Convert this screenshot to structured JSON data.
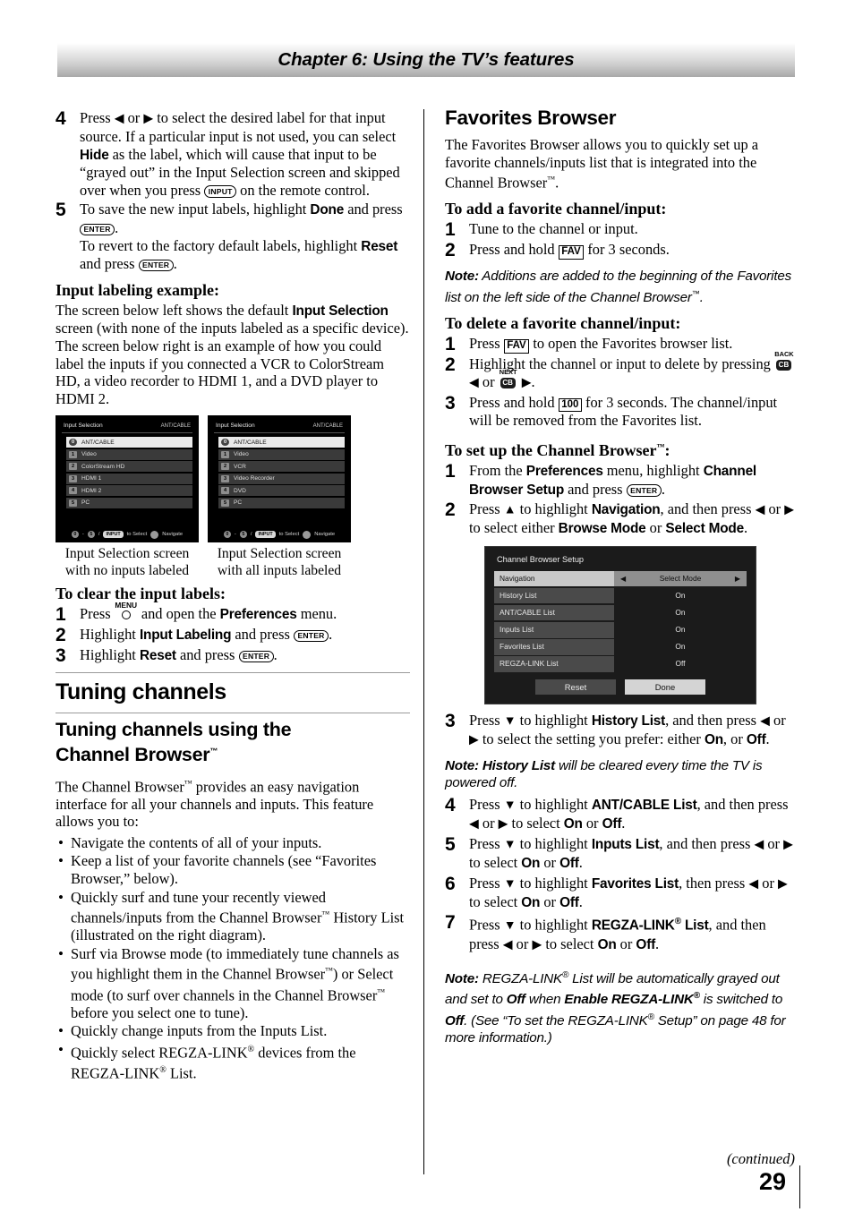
{
  "header": {
    "chapter_title": "Chapter 6: Using the TV’s features"
  },
  "left_column": {
    "step4": {
      "num": "4",
      "t1": "Press ",
      "t2": " or ",
      "t3": " to select the desired label for that input source. If a particular input is not used, you can select ",
      "bold1": "Hide",
      "t4": " as the label, which will cause that input to be “grayed out” in the Input Selection screen and skipped over when you press ",
      "key_input": "INPUT",
      "t5": " on the remote control."
    },
    "step5": {
      "num": "5",
      "t1": "To save the new input labels, highlight ",
      "bold1": "Done",
      "t2": " and press ",
      "key_enter": "ENTER",
      "t3": ".",
      "t4": "To revert to the factory default labels, highlight ",
      "bold2": "Reset",
      "t5": " and press ",
      "t6": "."
    },
    "input_labeling_heading": "Input labeling example:",
    "input_labeling_body_1": "The screen below left shows the default ",
    "input_labeling_bold": "Input Selection",
    "input_labeling_body_2": " screen (with none of the inputs labeled as a specific device). The screen below right is an example of how you could label the inputs if you connected a VCR to ColorStream HD, a video recorder to HDMI 1, and a DVD player to HDMI 2.",
    "osd_left": {
      "title": "Input Selection",
      "source": "ANT/CABLE",
      "items": [
        {
          "num": "0",
          "label": "ANT/CABLE",
          "selected": true
        },
        {
          "num": "1",
          "label": "Video",
          "selected": false
        },
        {
          "num": "2",
          "label": "ColorStream HD",
          "selected": false
        },
        {
          "num": "3",
          "label": "HDMI 1",
          "selected": false
        },
        {
          "num": "4",
          "label": "HDMI 2",
          "selected": false
        },
        {
          "num": "5",
          "label": "PC",
          "selected": false
        }
      ],
      "footer": {
        "range_from": "0",
        "dash": "-",
        "range_to": "5",
        "slash": "/",
        "key": "INPUT",
        "select_text": "to Select",
        "navigate_text": "Navigate"
      },
      "caption": "Input Selection screen with no inputs labeled"
    },
    "osd_right": {
      "title": "Input Selection",
      "source": "ANT/CABLE",
      "items": [
        {
          "num": "0",
          "label": "ANT/CABLE",
          "selected": true
        },
        {
          "num": "1",
          "label": "Video",
          "selected": false
        },
        {
          "num": "2",
          "label": "VCR",
          "selected": false
        },
        {
          "num": "3",
          "label": "Video Recorder",
          "selected": false
        },
        {
          "num": "4",
          "label": "DVD",
          "selected": false
        },
        {
          "num": "5",
          "label": "PC",
          "selected": false
        }
      ],
      "footer": {
        "range_from": "0",
        "dash": "-",
        "range_to": "5",
        "slash": "/",
        "key": "INPUT",
        "select_text": "to Select",
        "navigate_text": "Navigate"
      },
      "caption": "Input Selection screen with all inputs labeled"
    },
    "clear_heading": "To clear the input labels:",
    "clear_step1": {
      "num": "1",
      "t1": "Press ",
      "key_menu": "MENU",
      "t2": " and open the ",
      "bold1": "Preferences",
      "t3": " menu."
    },
    "clear_step2": {
      "num": "2",
      "t1": "Highlight ",
      "bold1": "Input Labeling",
      "t2": " and press ",
      "key_enter": "ENTER",
      "t3": "."
    },
    "clear_step3": {
      "num": "3",
      "t1": "Highlight ",
      "bold1": "Reset",
      "t2": " and press ",
      "key_enter": "ENTER",
      "t3": "."
    },
    "section_title": "Tuning channels",
    "subsection_title_line1": "Tuning channels using the",
    "subsection_title_line2": "Channel Browser",
    "subsection_tm": "™",
    "intro_1": "The Channel Browser",
    "intro_tm": "™",
    "intro_2": " provides an easy navigation interface for all your channels and inputs. This feature allows you to:",
    "bullets": [
      {
        "parts": [
          "Navigate the contents of all of your inputs."
        ]
      },
      {
        "parts": [
          "Keep a list of your favorite channels (see “Favorites Browser,” below)."
        ]
      },
      {
        "parts": [
          "Quickly surf and tune your recently viewed channels/inputs from the Channel Browser",
          "™",
          " History List (illustrated on the right diagram)."
        ]
      },
      {
        "parts": [
          "Surf via Browse mode (to immediately tune channels as you highlight them in the Channel Browser",
          "™",
          ") or Select mode (to surf over channels in the Channel Browser",
          "™",
          " before you select one to tune)."
        ]
      },
      {
        "parts": [
          "Quickly change inputs from the Inputs List."
        ]
      },
      {
        "parts": [
          "Quickly select REGZA-LINK",
          "®",
          " devices from the REGZA-LINK",
          "®",
          " List."
        ]
      }
    ]
  },
  "right_column": {
    "fav_heading": "Favorites Browser",
    "fav_intro_1": "The Favorites Browser allows you to quickly set up a favorite channels/inputs list that is integrated into the Channel Browser",
    "fav_intro_tm": "™",
    "fav_intro_2": ".",
    "add_heading": "To add a favorite channel/input:",
    "add_step1": {
      "num": "1",
      "text": "Tune to the channel or input."
    },
    "add_step2": {
      "num": "2",
      "t1": "Press and hold ",
      "key_fav": "FAV",
      "t2": " for 3 seconds."
    },
    "note_add": {
      "label": "Note:",
      "t1": " Additions are added to the beginning of the Favorites list on the left side of the Channel Browser",
      "tm": "™",
      "t2": "."
    },
    "delete_heading": "To delete a favorite channel/input:",
    "del_step1": {
      "num": "1",
      "t1": "Press ",
      "key_fav": "FAV",
      "t2": " to open the Favorites browser list."
    },
    "del_step2": {
      "num": "2",
      "t1": "Highlight the channel or input to delete by pressing ",
      "key_back_label": "BACK",
      "key_cb": "CB",
      "t2": " or ",
      "key_next_label": "NEXT",
      "t3": "."
    },
    "del_step3": {
      "num": "3",
      "t1": "Press and hold ",
      "key_100": "100",
      "t2": " for 3 seconds. The channel/input will be removed from the Favorites list."
    },
    "setup_heading_1": "To set up the Channel Browser",
    "setup_heading_tm": "™",
    "setup_heading_2": ":",
    "setup_step1": {
      "num": "1",
      "t1": "From the ",
      "bold1": "Preferences",
      "t2": " menu, highlight ",
      "bold2": "Channel Browser Setup",
      "t3": " and press ",
      "key_enter": "ENTER",
      "t4": "."
    },
    "setup_step2": {
      "num": "2",
      "t1": "Press ",
      "t2": " to highlight ",
      "bold1": "Navigation",
      "t3": ", and then press ",
      "t4": " or ",
      "t5": " to select either ",
      "bold2": "Browse Mode",
      "t6": " or ",
      "bold3": "Select Mode",
      "t7": "."
    },
    "cbs_osd": {
      "title": "Channel Browser Setup",
      "rows": [
        {
          "label": "Navigation",
          "value": "Select Mode",
          "highlighted": true
        },
        {
          "label": "History List",
          "value": "On",
          "highlighted": false
        },
        {
          "label": "ANT/CABLE List",
          "value": "On",
          "highlighted": false
        },
        {
          "label": "Inputs List",
          "value": "On",
          "highlighted": false
        },
        {
          "label": "Favorites List",
          "value": "On",
          "highlighted": false
        },
        {
          "label": "REGZA-LINK List",
          "value": "Off",
          "highlighted": false
        }
      ],
      "reset_label": "Reset",
      "done_label": "Done"
    },
    "setup_step3": {
      "num": "3",
      "t1": "Press ",
      "t2": " to highlight ",
      "bold1": "History List",
      "t3": ", and then press ",
      "t4": " or ",
      "t5": " to select the setting you prefer: either ",
      "bold2": "On",
      "t6": ", or ",
      "bold3": "Off",
      "t7": "."
    },
    "note_history": {
      "label": "Note: History List",
      "text": " will be cleared every time the TV is powered off."
    },
    "setup_step4": {
      "num": "4",
      "t1": "Press ",
      "t2": " to highlight ",
      "bold1": "ANT/CABLE List",
      "t3": ", and then press ",
      "t4": " or ",
      "t5": " to select ",
      "bold2": "On",
      "t6": " or ",
      "bold3": "Off",
      "t7": "."
    },
    "setup_step5": {
      "num": "5",
      "t1": "Press ",
      "t2": " to highlight ",
      "bold1": "Inputs List",
      "t3": ", and then press ",
      "t4": " or ",
      "t5": " to select ",
      "bold2": "On",
      "t6": " or ",
      "bold3": "Off",
      "t7": "."
    },
    "setup_step6": {
      "num": "6",
      "t1": "Press ",
      "t2": " to highlight ",
      "bold1": "Favorites List",
      "t3": ", then press ",
      "t4": " or ",
      "t5": " to select ",
      "bold2": "On",
      "t6": " or ",
      "bold3": "Off",
      "t7": "."
    },
    "setup_step7": {
      "num": "7",
      "t1": "Press ",
      "t2": " to highlight ",
      "bold1": "REGZA-LINK",
      "reg": "®",
      "bold1b": " List",
      "t3": ", and then press ",
      "t4": " or ",
      "t5": " to select ",
      "bold2": "On",
      "t6": " or ",
      "bold3": "Off",
      "t7": "."
    },
    "note_regza": {
      "label": "Note:",
      "t1": " REGZA-LINK",
      "reg1": "®",
      "t2": " List will be automatically grayed out and set to ",
      "b1": "Off",
      "t3": " when ",
      "b2": "Enable REGZA-LINK",
      "reg2": "®",
      "t4": " is switched to ",
      "b3": "Off",
      "t5": ". (See “To set the REGZA-LINK",
      "reg3": "®",
      "t6": " Setup” on page 48 for more information.)"
    }
  },
  "footer": {
    "continued": "(continued)",
    "page_number": "29"
  },
  "glyphs": {
    "left_arrow": "◀",
    "right_arrow": "▶",
    "up_arrow": "▲",
    "down_arrow": "▼",
    "bullet": "•"
  }
}
